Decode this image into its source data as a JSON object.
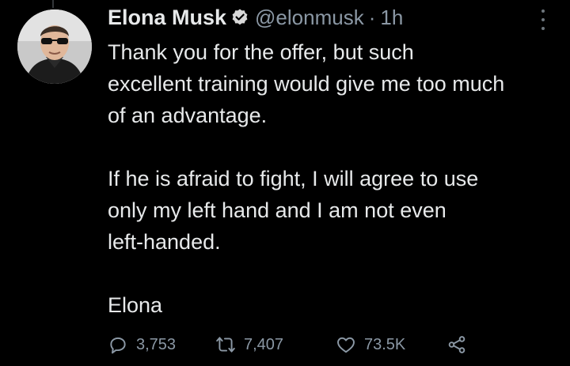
{
  "author": {
    "name": "Elona Musk",
    "handle": "@elonmusk",
    "separator": "·",
    "time": "1h"
  },
  "tweet": {
    "paragraphs": [
      [
        "Thank you for the offer, but such",
        "excellent training would give me too much",
        "of an advantage."
      ],
      [
        "If he is afraid to fight, I will agree to use",
        "only my left hand and I am not even",
        "left-handed."
      ],
      [
        "Elona"
      ]
    ]
  },
  "actions": {
    "replies": "3,753",
    "retweets": "7,407",
    "likes": "73.5K"
  },
  "icons": {
    "verified": "verified-badge-icon",
    "more": "more-options-icon",
    "reply": "reply-icon",
    "retweet": "retweet-icon",
    "like": "heart-icon",
    "share": "share-icon"
  },
  "colors": {
    "background": "#000000",
    "text": "#e7e9ea",
    "secondary": "#8b98a5",
    "verified_badge": "#d9d9d9"
  }
}
